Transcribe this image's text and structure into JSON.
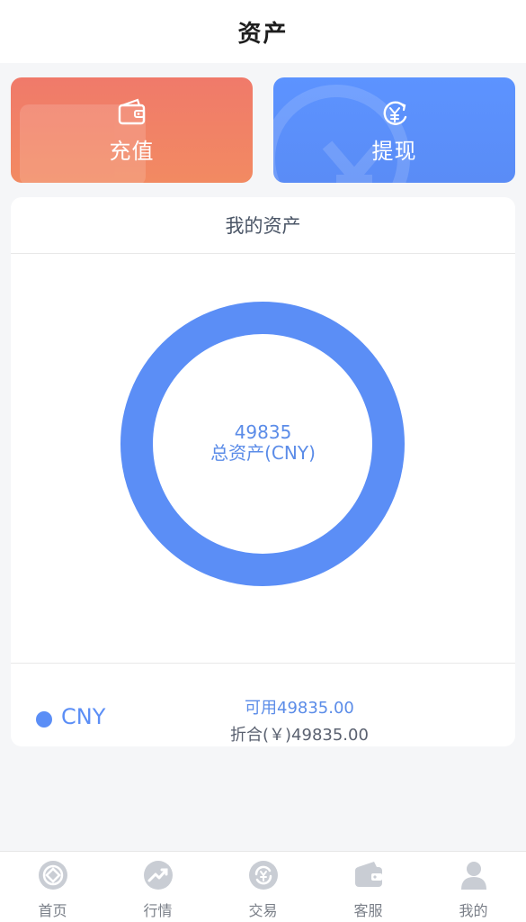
{
  "header": {
    "title": "资产"
  },
  "actions": {
    "recharge": {
      "label": "充值",
      "icon": "wallet-icon",
      "color": "#f07a6a"
    },
    "withdraw": {
      "label": "提现",
      "icon": "yuan-refresh-icon",
      "color": "#5c93ff"
    }
  },
  "assets": {
    "section_title": "我的资产",
    "total_value": "49835",
    "total_label": "总资产(CNY)",
    "donut_color": "#5b8ef6",
    "items": [
      {
        "currency": "CNY",
        "available": "可用49835.00",
        "equivalent": "折合(￥)49835.00"
      }
    ]
  },
  "chart_data": {
    "type": "pie",
    "categories": [
      "CNY"
    ],
    "values": [
      49835
    ],
    "title": "",
    "donut": true
  },
  "tabbar": {
    "items": [
      {
        "label": "首页",
        "icon": "home-icon"
      },
      {
        "label": "行情",
        "icon": "trend-chart-icon"
      },
      {
        "label": "交易",
        "icon": "exchange-icon"
      },
      {
        "label": "客服",
        "icon": "wallet-icon"
      },
      {
        "label": "我的",
        "icon": "user-icon"
      }
    ]
  }
}
